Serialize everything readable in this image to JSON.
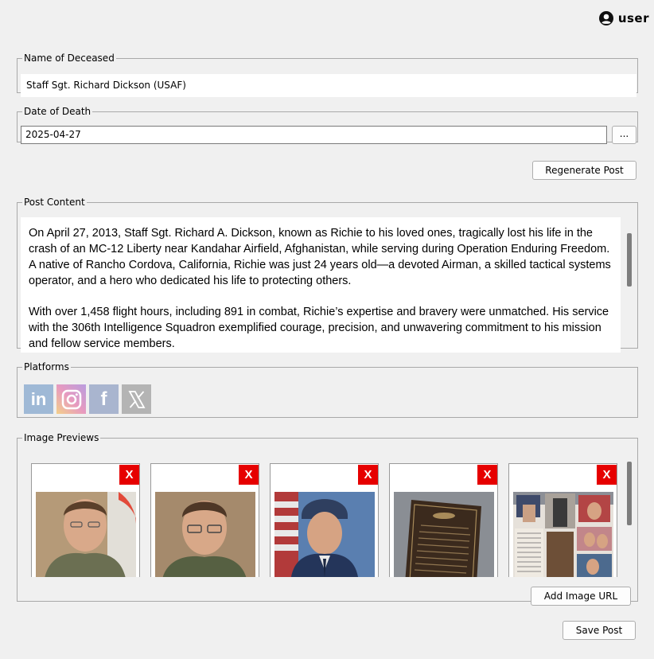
{
  "header": {
    "user_label": "user",
    "user_icon": "user-circle-icon"
  },
  "deceased": {
    "legend": "Name of Deceased",
    "value": "Staff Sgt. Richard Dickson (USAF)"
  },
  "death_date": {
    "legend": "Date of Death",
    "value": "2025-04-27",
    "picker_label": "..."
  },
  "actions": {
    "regenerate_label": "Regenerate Post",
    "add_image_url_label": "Add Image URL",
    "save_label": "Save Post"
  },
  "post": {
    "legend": "Post Content",
    "paragraphs": [
      "On April 27, 2013, Staff Sgt. Richard A. Dickson, known as Richie to his loved ones, tragically lost his life in the crash of an MC-12 Liberty near Kandahar Airfield, Afghanistan, while serving during Operation Enduring Freedom. A native of Rancho Cordova, California, Richie was just 24 years old—a devoted Airman, a skilled tactical systems operator, and a hero who dedicated his life to protecting others.",
      "With over 1,458 flight hours, including 891 in combat, Richie’s expertise and bravery were unmatched. His service with the 306th Intelligence Squadron exemplified courage, precision, and unwavering commitment to his mission and fellow service members."
    ]
  },
  "platforms": {
    "legend": "Platforms",
    "items": [
      {
        "name": "LinkedIn",
        "icon": "linkedin-icon",
        "glyph": "in"
      },
      {
        "name": "Instagram",
        "icon": "instagram-icon",
        "glyph": ""
      },
      {
        "name": "Facebook",
        "icon": "facebook-icon",
        "glyph": "f"
      },
      {
        "name": "X",
        "icon": "x-icon",
        "glyph": ""
      }
    ]
  },
  "images": {
    "legend": "Image Previews",
    "remove_label": "X",
    "items": [
      {
        "description": "portrait-flight-suit"
      },
      {
        "description": "portrait-glasses"
      },
      {
        "description": "portrait-dress-blues-flag"
      },
      {
        "description": "memorial-plaque"
      },
      {
        "description": "photo-collage"
      }
    ]
  },
  "colors": {
    "remove_button": "#e60000",
    "background": "#f0f0f0"
  }
}
